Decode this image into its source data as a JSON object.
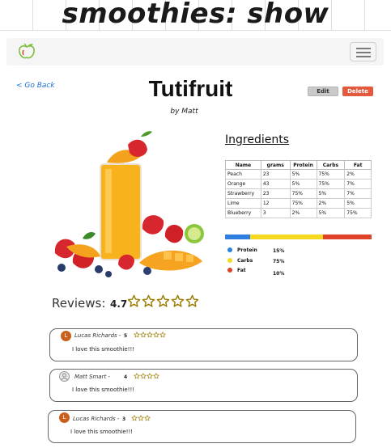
{
  "banner": {
    "title": "smoothies: show"
  },
  "navbar": {
    "logo_icon": "apple-icon",
    "toggle_icon": "hamburger-icon"
  },
  "back_link": "< Go Back",
  "smoothie": {
    "name": "Tutifruit",
    "author": "by Matt",
    "image_icon": "smoothie-photo"
  },
  "actions": {
    "edit_label": "Edit",
    "delete_label": "Delete"
  },
  "ingredients": {
    "heading": "Ingredients",
    "columns": [
      "Name",
      "grams",
      "Protein",
      "Carbs",
      "Fat"
    ],
    "rows": [
      [
        "Peach",
        "23",
        "5%",
        "75%",
        "2%"
      ],
      [
        "Orange",
        "43",
        "5%",
        "75%",
        "7%"
      ],
      [
        "Strawberry",
        "23",
        "75%",
        "5%",
        "7%"
      ],
      [
        "Lime",
        "12",
        "75%",
        "2%",
        "5%"
      ],
      [
        "Blueberry",
        "3",
        "2%",
        "5%",
        "75%"
      ]
    ]
  },
  "macros": {
    "items": [
      {
        "label": "Protein",
        "value": "15%",
        "fraction": 0.17,
        "color": "#2f7fe0"
      },
      {
        "label": "Carbs",
        "value": "75%",
        "fraction": 0.5,
        "color": "#f5d921"
      },
      {
        "label": "Fat",
        "value": "10%",
        "fraction": 0.33,
        "color": "#e0432a"
      }
    ]
  },
  "reviews": {
    "label": "Reviews:",
    "average": "4.7",
    "average_stars": 5,
    "list": [
      {
        "avatar_letter": "L",
        "name": "Lucas Richards -",
        "score": "5",
        "stars": 5,
        "text": "I love this smoothie!!!"
      },
      {
        "avatar_letter": "",
        "name": "Matt Smart -",
        "score": "4",
        "stars": 4,
        "text": "I love this smoothie!!!"
      },
      {
        "avatar_letter": "L",
        "name": "Lucas Richards -",
        "score": "3",
        "stars": 3,
        "text": "I love this smoothie!!!"
      }
    ]
  },
  "colors": {
    "accent_link": "#1e6fd9",
    "delete": "#e35a3c",
    "star": "#c9a400",
    "avatar": "#c95f1c"
  }
}
